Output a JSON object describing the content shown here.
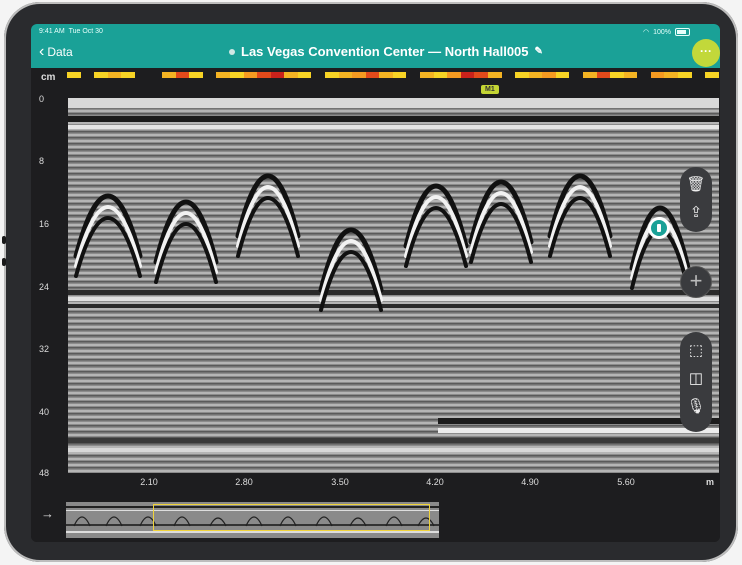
{
  "status_bar": {
    "time": "9:41 AM",
    "date": "Tue Oct 30",
    "battery": "100%"
  },
  "nav": {
    "back_label": "Data",
    "title": "Las Vegas Convention Center — North Hall005",
    "more_label": "···"
  },
  "depth_unit": "cm",
  "distance_unit": "m",
  "depth_ticks": [
    "0",
    "8",
    "16",
    "24",
    "32",
    "40",
    "48"
  ],
  "distance_ticks": [
    "2.10",
    "2.80",
    "3.50",
    "4.20",
    "4.90",
    "5.60"
  ],
  "marker_label": "M1",
  "heat_colors": [
    "#f7d325",
    "#1d1d1f",
    "#f4b323",
    "#e24a1b",
    "#f7d325",
    "#1d1d1f",
    "#f59a21",
    "#c9221b"
  ],
  "accent_color": "#1aa197",
  "tools_top": [
    "trash-icon",
    "share-icon"
  ],
  "tools_bottom": [
    "select-area-icon",
    "split-view-icon",
    "microphone-icon"
  ]
}
